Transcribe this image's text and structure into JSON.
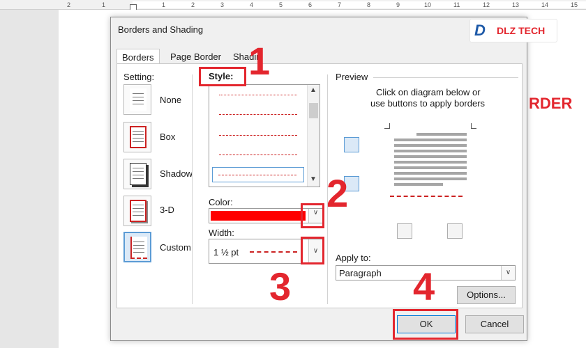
{
  "ruler": {
    "ticks": [
      "2",
      "1",
      "1",
      "2",
      "3",
      "4",
      "5",
      "6",
      "7",
      "8",
      "9",
      "10",
      "11",
      "12",
      "13",
      "14",
      "15"
    ]
  },
  "document": {
    "heading": "RDER"
  },
  "dialog": {
    "title": "Borders and Shading",
    "logo_text": "DLZ TECH",
    "tabs": [
      {
        "label": "Borders",
        "active": true
      },
      {
        "label": "Page Border",
        "active": false
      },
      {
        "label": "Shadin",
        "active": false
      }
    ],
    "setting": {
      "label": "Setting:",
      "options": [
        {
          "label": "None",
          "selected": false
        },
        {
          "label": "Box",
          "selected": false
        },
        {
          "label": "Shadow",
          "selected": false
        },
        {
          "label": "3-D",
          "selected": false
        },
        {
          "label": "Custom",
          "selected": true
        }
      ]
    },
    "style": {
      "label": "Style:"
    },
    "color": {
      "label": "Color:",
      "value_hex": "#ff0000"
    },
    "width": {
      "label": "Width:",
      "value": "1 ½ pt"
    },
    "preview": {
      "title": "Preview",
      "hint_line1": "Click on diagram below or",
      "hint_line2": "use buttons to apply borders"
    },
    "apply_to": {
      "label": "Apply to:",
      "value": "Paragraph"
    },
    "buttons": {
      "options": "Options...",
      "ok": "OK",
      "cancel": "Cancel"
    }
  },
  "callouts": [
    "1",
    "2",
    "3",
    "4"
  ],
  "colors": {
    "accent_red": "#e3262e",
    "selection_blue": "#5b9bd5",
    "dialog_bg": "#f0f0f0"
  }
}
